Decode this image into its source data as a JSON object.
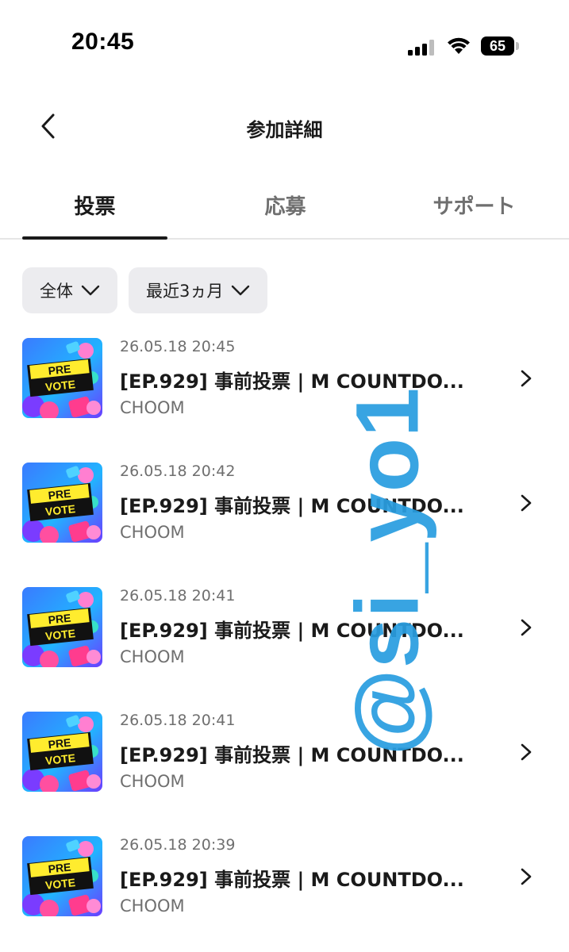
{
  "status_bar": {
    "time": "20:45",
    "battery": "65"
  },
  "header": {
    "title": "参加詳細"
  },
  "tabs": [
    {
      "label": "投票",
      "active": true
    },
    {
      "label": "応募",
      "active": false
    },
    {
      "label": "サポート",
      "active": false
    }
  ],
  "filters": [
    {
      "label": "全体"
    },
    {
      "label": "最近3ヵ月"
    }
  ],
  "thumbnail_text": {
    "line1": "PRE",
    "line2": "VOTE"
  },
  "items": [
    {
      "date": "26.05.18 20:45",
      "title": "[EP.929] 事前投票 | M COUNTDO...",
      "sub": "CHOOM"
    },
    {
      "date": "26.05.18 20:42",
      "title": "[EP.929] 事前投票 | M COUNTDO...",
      "sub": "CHOOM"
    },
    {
      "date": "26.05.18 20:41",
      "title": "[EP.929] 事前投票 | M COUNTDO...",
      "sub": "CHOOM"
    },
    {
      "date": "26.05.18 20:41",
      "title": "[EP.929] 事前投票 | M COUNTDO...",
      "sub": "CHOOM"
    },
    {
      "date": "26.05.18 20:39",
      "title": "[EP.929] 事前投票 | M COUNTDO...",
      "sub": "CHOOM"
    }
  ],
  "watermark": "@si_yo1",
  "colors": {
    "accent": "#1a1a1a",
    "chip_bg": "#ececef",
    "watermark": "#2a9ee0"
  }
}
